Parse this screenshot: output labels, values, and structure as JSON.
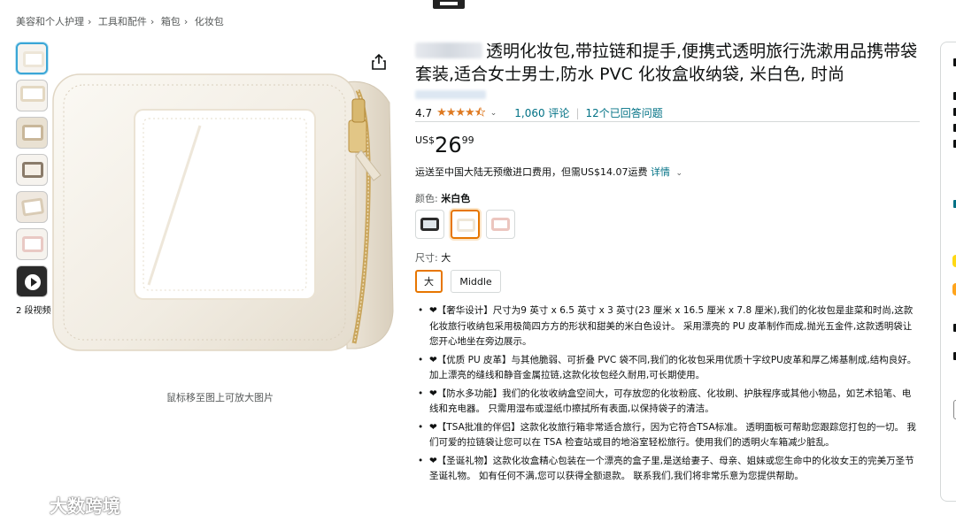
{
  "breadcrumb": [
    "美容和个人护理",
    "工具和配件",
    "箱包",
    "化妆包"
  ],
  "gallery": {
    "thumb_names": [
      "thumb-1",
      "thumb-2",
      "thumb-3",
      "thumb-4",
      "thumb-5",
      "thumb-6"
    ],
    "video_label": "2 段视频",
    "zoom_hint": "鼠标移至图上可放大图片"
  },
  "product": {
    "title": "透明化妆包,带拉链和提手,便携式透明旅行洗漱用品携带袋套装,适合女士男士,防水 PVC 化妆盒收纳袋, 米白色, 时尚",
    "rating": "4.7",
    "ratings_count": "1,060 评论",
    "questions": "12个已回答问题",
    "price_currency": "US$",
    "price_whole": "26",
    "price_fraction": "99",
    "shipping_text": "运送至中国大陆无预缴进口费用，但需US$14.07运费",
    "shipping_details": "详情",
    "color_label": "颜色:",
    "color_value": "米白色",
    "colors": [
      "黑色",
      "米白色",
      "粉色"
    ],
    "size_label": "尺寸:",
    "size_value": "大",
    "sizes": [
      "大",
      "Middle"
    ],
    "bullets": [
      "❤【奢华设计】尺寸为9 英寸 x 6.5 英寸 x 3 英寸(23 厘米 x 16.5 厘米 x 7.8 厘米),我们的化妆包是韭菜和时尚,这款化妆旅行收纳包采用极简四方方的形状和甜美的米白色设计。 采用漂亮的 PU 皮革制作而成,抛光五金件,这款透明袋让您开心地坐在旁边展示。",
      "❤【优质 PU 皮革】与其他脆弱、可折叠 PVC 袋不同,我们的化妆包采用优质十字纹PU皮革和厚乙烯基制成,结构良好。 加上漂亮的缝线和静音金属拉链,这款化妆包经久耐用,可长期使用。",
      "❤【防水多功能】我们的化妆收纳盒空间大，可存放您的化妆粉底、化妆刷、护肤程序或其他小物品，如艺术铅笔、电线和充电器。 只需用湿布或湿纸巾擦拭所有表面,以保持袋子的清洁。",
      "❤【TSA批准的伴侣】这款化妆旅行箱非常适合旅行，因为它符合TSA标准。 透明面板可帮助您跟踪您打包的一切。 我们可爱的拉链袋让您可以在 TSA 检查站或目的地浴室轻松旅行。使用我们的透明火车箱减少脏乱。",
      "❤【圣诞礼物】这款化妆盒精心包装在一个漂亮的盒子里,是送给妻子、母亲、姐妹或您生命中的化妆女王的完美万圣节圣诞礼物。 如有任何不满,您可以获得全额退款。 联系我们,我们将非常乐意为您提供帮助。"
    ]
  },
  "watermark": "大数跨境",
  "colors_theme": {
    "link": "#007185",
    "star": "#de7921",
    "selected_border": "#e77600",
    "cream": "#f3eee6"
  }
}
